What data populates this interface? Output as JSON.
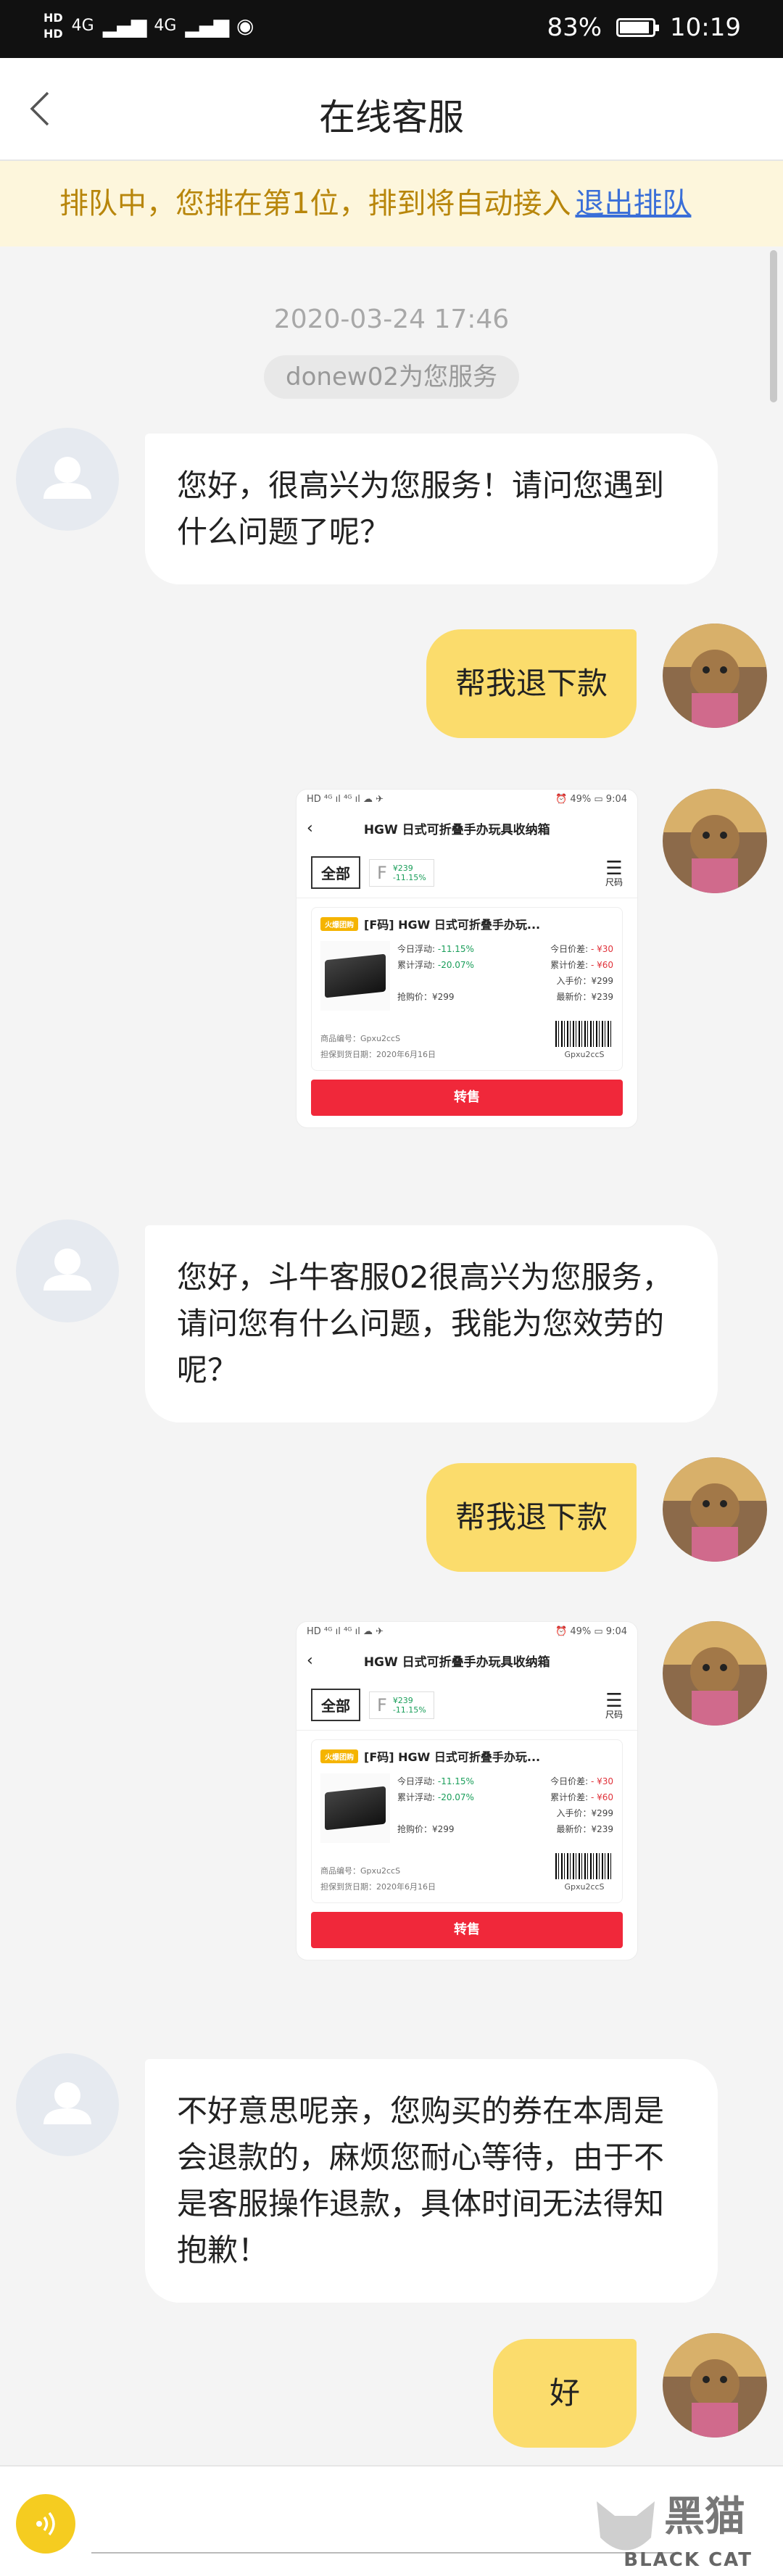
{
  "status_bar": {
    "hd1": "HD",
    "hd2": "HD",
    "net1": "4G",
    "net2": "4G",
    "battery_percent": "83%",
    "battery_level": 0.83,
    "time": "10:19"
  },
  "header": {
    "title": "在线客服"
  },
  "queue": {
    "text": "排队中，您排在第1位，排到将自动接入",
    "link": "退出排队"
  },
  "chat": {
    "timestamp": "2020-03-24 17:46",
    "service_pill": "donew02为您服务",
    "messages": [
      {
        "from": "agent",
        "text": "您好，很高兴为您服务！请问您遇到什么问题了呢？"
      },
      {
        "from": "user",
        "text": "帮我退下款"
      },
      {
        "from": "user",
        "type": "image"
      },
      {
        "from": "agent",
        "text": "您好，斗牛客服02很高兴为您服务，请问您有什么问题，我能为您效劳的呢？"
      },
      {
        "from": "user",
        "text": "帮我退下款"
      },
      {
        "from": "user",
        "type": "image"
      },
      {
        "from": "agent",
        "text": "不好意思呢亲，您购买的券在本周是会退款的，麻烦您耐心等待，由于不是客服操作退款，具体时间无法得知抱歉！"
      },
      {
        "from": "user",
        "text": "好"
      }
    ]
  },
  "card": {
    "status_left": "HD ⁴ᴳ ıl ⁴ᴳ ıl ☁ ✈",
    "status_right": "⏰ 49% ▭ 9:04",
    "title": "HGW 日式可折叠手办玩具收纳箱",
    "filter_all": "全部",
    "filter_f": "F",
    "filter_price": "¥239",
    "filter_change": "-11.15%",
    "menu_label": "尺码",
    "tag": "火爆团购",
    "item_title": "[F码] HGW 日式可折叠手办玩...",
    "today_float_label": "今日浮动:",
    "today_float": "-11.15%",
    "today_price_label": "今日价差:",
    "today_price": "- ¥30",
    "total_float_label": "累计浮动:",
    "total_float": "-20.07%",
    "total_price_label": "累计价差:",
    "total_price": "- ¥60",
    "entry_price": "入手价：¥299",
    "buy_price": "抢购价：¥299",
    "latest_price": "最新价：¥239",
    "goods_no": "商品编号：Gpxu2ccS",
    "delivery": "担保到货日期：2020年6月16日",
    "barcode_text": "Gpxu2ccS",
    "sell_button": "转售"
  },
  "watermark": {
    "cn": "黑猫",
    "en": "BLACK CAT"
  },
  "colors": {
    "accent": "#fbdc6c",
    "queue_bg": "#fdf6dc",
    "queue_text": "#b8860b",
    "link": "#3a6fd8"
  }
}
